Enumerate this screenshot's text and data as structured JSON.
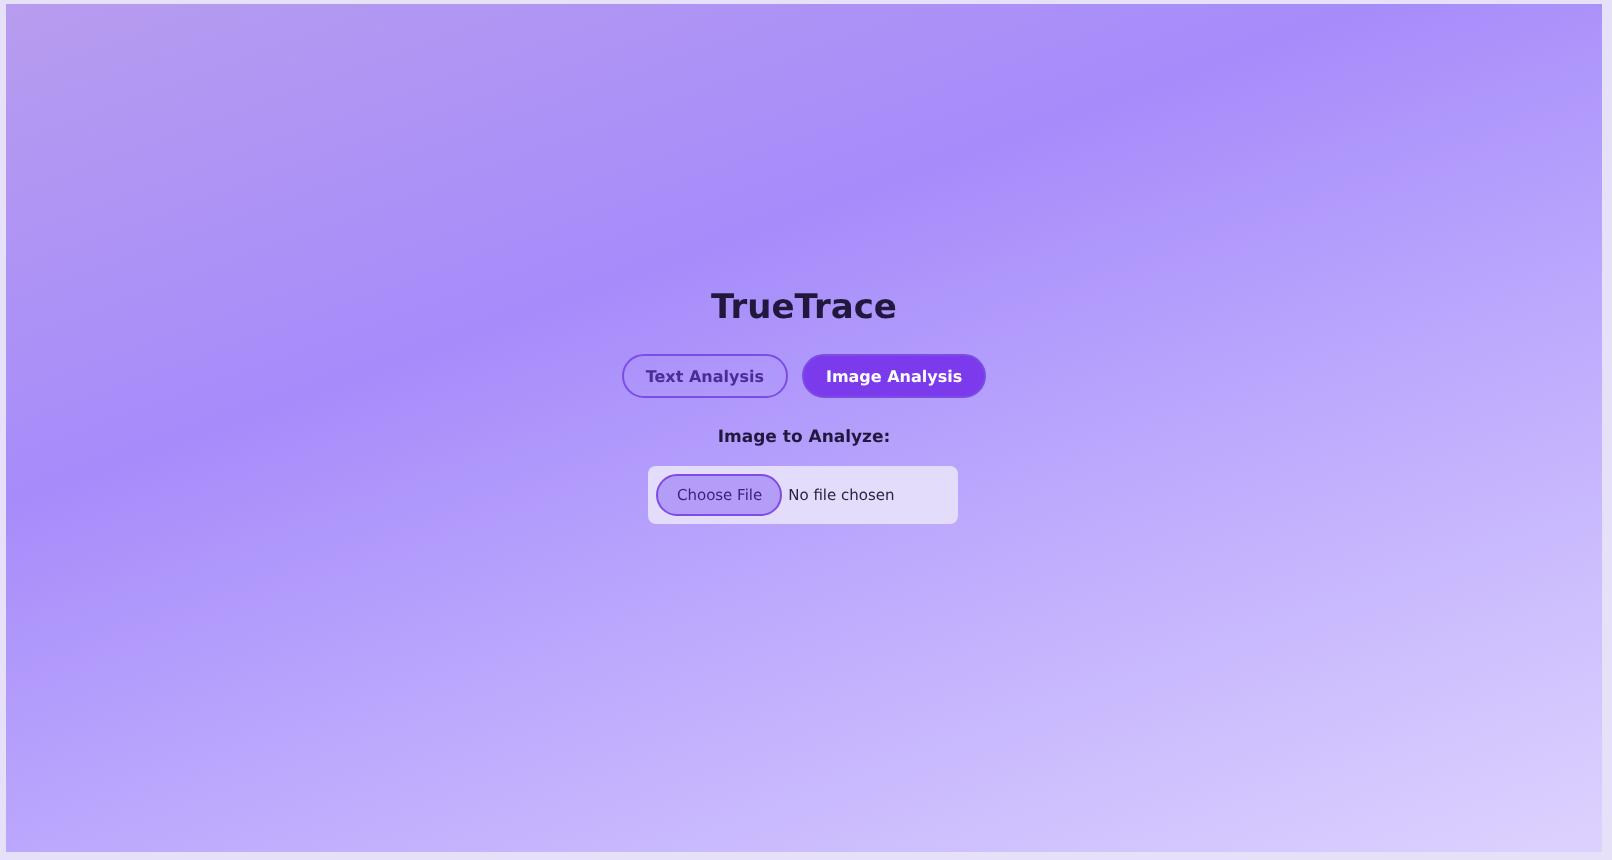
{
  "title": "TrueTrace",
  "tabs": [
    {
      "label": "Text Analysis",
      "selected": false
    },
    {
      "label": "Image Analysis",
      "selected": true
    }
  ],
  "file_input": {
    "label": "Image to Analyze:",
    "button": "Choose File",
    "status": "No file chosen"
  }
}
